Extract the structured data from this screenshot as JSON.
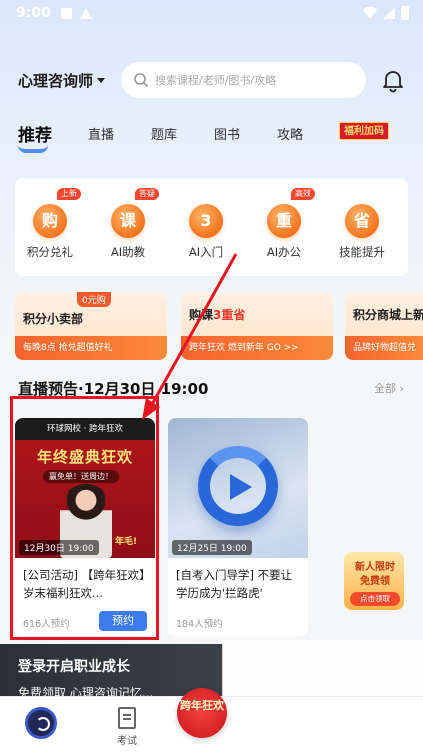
{
  "status_bar": {
    "time": "9:00"
  },
  "header": {
    "category": "心理咨询师",
    "search_placeholder": "搜索课程/老师/图书/攻略"
  },
  "tabs": [
    {
      "label": "推荐",
      "active": true
    },
    {
      "label": "直播"
    },
    {
      "label": "题库"
    },
    {
      "label": "图书"
    },
    {
      "label": "攻略"
    },
    {
      "label": "福利加码"
    }
  ],
  "quick_actions": [
    {
      "label": "积分兑礼",
      "glyph": "购",
      "badge": "上新"
    },
    {
      "label": "AI助教",
      "glyph": "课",
      "badge": "答疑"
    },
    {
      "label": "AI入门",
      "glyph": "3",
      "badge": ""
    },
    {
      "label": "AI办公",
      "glyph": "重",
      "badge": "高效"
    },
    {
      "label": "技能提升",
      "glyph": "省",
      "badge": ""
    }
  ],
  "promos": [
    {
      "title": "积分小卖部",
      "tag": "0元购",
      "subtitle": "每晚8点 抢兑超值好礼"
    },
    {
      "title_prefix": "购课",
      "title_highlight": "3重省",
      "subtitle": "跨年狂欢 燃到新年 GO >>"
    },
    {
      "title": "积分商城上新",
      "subtitle": "品牌好物超值兑"
    }
  ],
  "section": {
    "title": "直播预告·12月30日 19:00",
    "all_label": "全部"
  },
  "courses": [
    {
      "header": "环球网校 · 跨年狂欢",
      "banner": "年终盛典狂欢",
      "chip": "赢免单！送周边！",
      "extra": "年毛!",
      "date": "12月30日 19:00",
      "title": "[公司活动] 【跨年狂欢】岁末福利狂欢...",
      "count": "616人预约",
      "button": "预约"
    },
    {
      "date": "12月25日 19:00",
      "title": "[自考入门导学] 不要让学历成为'拦路虎'",
      "count": "184人预约"
    }
  ],
  "side_promo": {
    "line1": "新人限时",
    "line2": "免费领",
    "button": "点击领取"
  },
  "login_bar": {
    "title": "登录开启职业成长",
    "subtitle": "免费领取 心理咨询记忆..."
  },
  "tabbar": {
    "exam_label": "考试",
    "center_label": "跨年狂欢"
  },
  "colors": {
    "accent": "#3c7cf0",
    "highlight": "#e8141f",
    "orange": "#f3741c"
  }
}
